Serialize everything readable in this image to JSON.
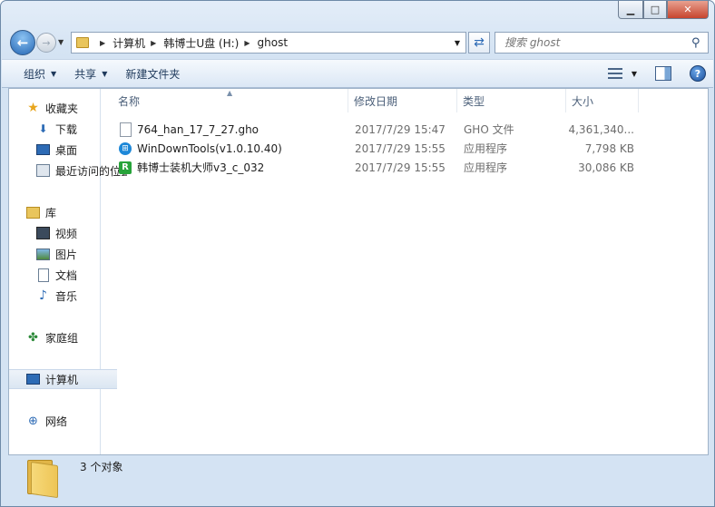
{
  "window": {
    "controls": {
      "minimize": "▁",
      "maximize": "□",
      "close": "✕"
    }
  },
  "address": {
    "crumbs": [
      "计算机",
      "韩博士U盘 (H:)",
      "ghost"
    ]
  },
  "search": {
    "placeholder": "搜索 ghost"
  },
  "toolbar": {
    "organize": "组织",
    "share": "共享",
    "new_folder": "新建文件夹"
  },
  "nav": {
    "favorites": "收藏夹",
    "downloads": "下载",
    "desktop": "桌面",
    "recent": "最近访问的位置",
    "libraries": "库",
    "videos": "视频",
    "pictures": "图片",
    "documents": "文档",
    "music": "音乐",
    "homegroup": "家庭组",
    "computer": "计算机",
    "network": "网络"
  },
  "columns": {
    "name": "名称",
    "date": "修改日期",
    "type": "类型",
    "size": "大小"
  },
  "files": [
    {
      "name": "764_han_17_7_27.gho",
      "date": "2017/7/29 15:47",
      "type": "GHO 文件",
      "size": "4,361,340...",
      "icon": "document-icon"
    },
    {
      "name": "WinDownTools(v1.0.10.40)",
      "date": "2017/7/29 15:55",
      "type": "应用程序",
      "size": "7,798 KB",
      "icon": "windows-app-icon"
    },
    {
      "name": "韩博士装机大师v3_c_032",
      "date": "2017/7/29 15:55",
      "type": "应用程序",
      "size": "30,086 KB",
      "icon": "hanboshi-app-icon"
    }
  ],
  "status": {
    "text": "3 个对象"
  },
  "colors": {
    "accent": "#2466b4",
    "window_frame": "#d4e3f3"
  }
}
